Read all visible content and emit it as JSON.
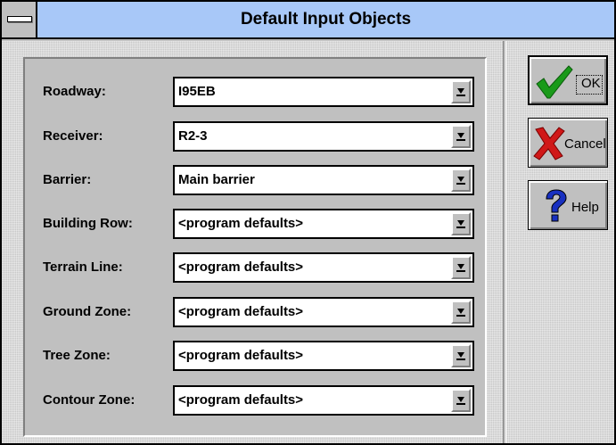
{
  "window": {
    "title": "Default Input Objects"
  },
  "fields": [
    {
      "label": "Roadway:",
      "value": "I95EB"
    },
    {
      "label": "Receiver:",
      "value": "R2-3"
    },
    {
      "label": "Barrier:",
      "value": "Main barrier"
    },
    {
      "label": "Building Row:",
      "value": "<program defaults>"
    },
    {
      "label": "Terrain Line:",
      "value": "<program defaults>"
    },
    {
      "label": "Ground Zone:",
      "value": "<program defaults>"
    },
    {
      "label": "Tree Zone:",
      "value": "<program defaults>"
    },
    {
      "label": "Contour Zone:",
      "value": "<program defaults>"
    }
  ],
  "buttons": {
    "ok": {
      "label": "OK",
      "icon": "green-checkmark-icon"
    },
    "cancel": {
      "label": "Cancel",
      "icon": "red-x-icon"
    },
    "help": {
      "label": "Help",
      "icon": "question-mark-icon"
    }
  },
  "colors": {
    "titlebar": "#a8c8f8",
    "face": "#c0c0c0",
    "check_green": "#1a9a1a",
    "cancel_red": "#d01818",
    "help_blue": "#1830c0"
  }
}
